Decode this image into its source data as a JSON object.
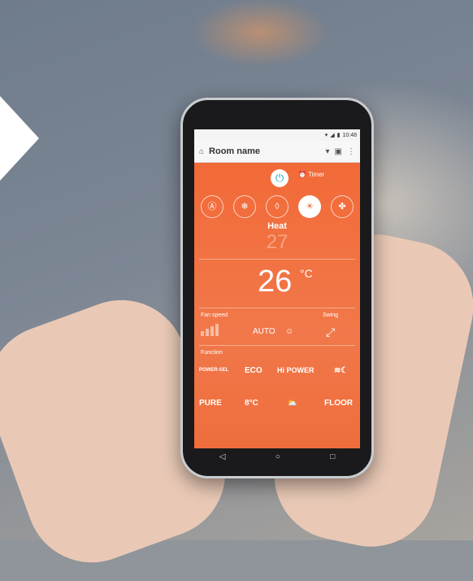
{
  "status_bar": {
    "time": "10:48"
  },
  "app_bar": {
    "title": "Room name",
    "home_icon": "home-icon",
    "dropdown_icon": "chevron-down-icon",
    "schedule_icon": "calendar-icon",
    "menu_icon": "more-vert-icon"
  },
  "controls": {
    "power_icon": "power-icon",
    "timer_label": "Timer",
    "modes": [
      {
        "icon": "auto-mode-icon",
        "glyph": "Ⓐ"
      },
      {
        "icon": "cool-mode-icon",
        "glyph": "❄"
      },
      {
        "icon": "dry-mode-icon",
        "glyph": "💧"
      },
      {
        "icon": "heat-mode-icon",
        "glyph": "☀"
      },
      {
        "icon": "fan-mode-icon",
        "glyph": "✤"
      }
    ],
    "mode_label": "Heat",
    "set_temperature": "27",
    "current_temperature": "26",
    "unit": "°C"
  },
  "fan": {
    "label": "Fan speed",
    "value": "AUTO",
    "swing_label": "Swing"
  },
  "function": {
    "label": "Function",
    "row1": [
      "POWER-SEL",
      "ECO",
      "Hi POWER",
      ""
    ],
    "row2": [
      "PURE",
      "8°C",
      "",
      "FLOOR"
    ]
  },
  "nav": {
    "back": "◁",
    "home": "○",
    "recent": "□"
  }
}
